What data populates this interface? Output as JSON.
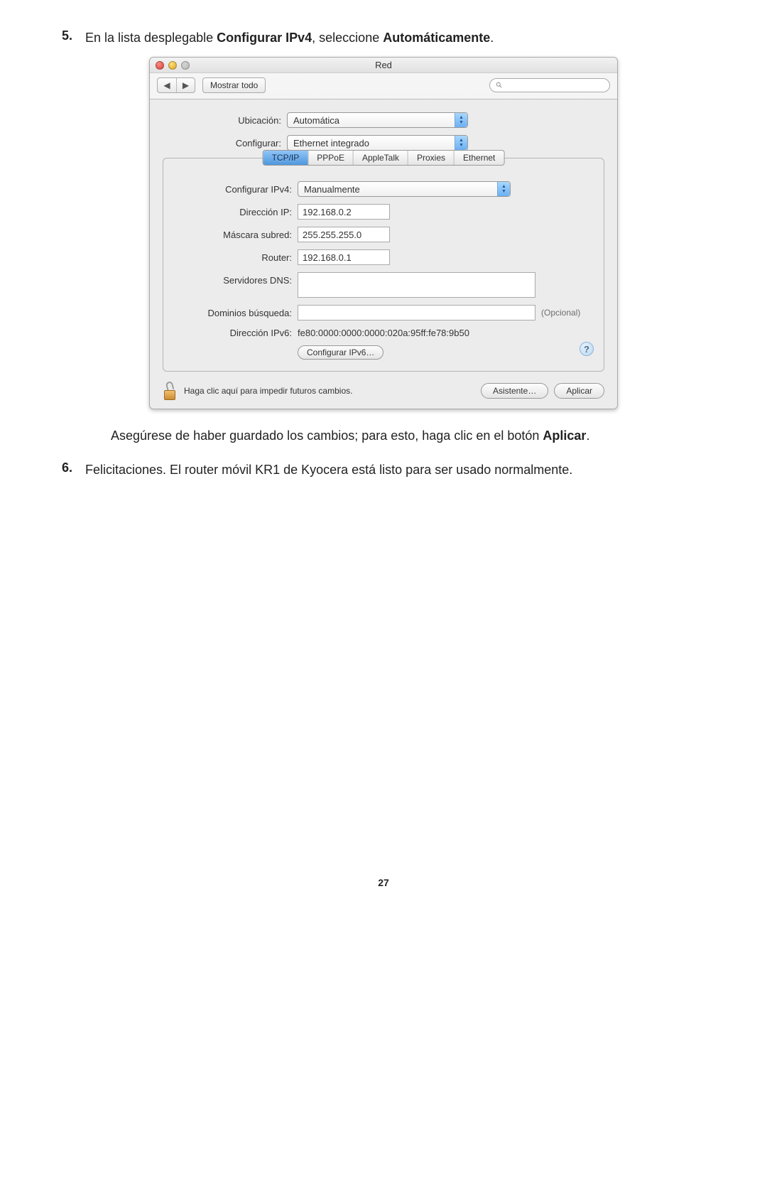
{
  "instructions": {
    "step5_num": "5.",
    "step5_pre": "En la lista desplegable ",
    "step5_b1": "Configurar IPv4",
    "step5_mid": ", seleccione ",
    "step5_b2": "Automáticamente",
    "step5_post": ".",
    "after1a": "Asegúrese de haber guardado los cambios; para esto, haga clic en el botón ",
    "after1b": "Aplicar",
    "after1c": ".",
    "step6_num": "6.",
    "step6_text": "Felicitaciones. El router móvil KR1 de Kyocera está listo para ser usado normalmente."
  },
  "window": {
    "title": "Red",
    "show_all": "Mostrar todo",
    "location_label": "Ubicación:",
    "location_value": "Automática",
    "configure_label": "Configurar:",
    "configure_value": "Ethernet integrado",
    "tabs": {
      "tcpip": "TCP/IP",
      "pppoe": "PPPoE",
      "appletalk": "AppleTalk",
      "proxies": "Proxies",
      "ethernet": "Ethernet"
    },
    "ipv4_label": "Configurar IPv4:",
    "ipv4_value": "Manualmente",
    "ip_label": "Dirección IP:",
    "ip_value": "192.168.0.2",
    "subnet_label": "Máscara subred:",
    "subnet_value": "255.255.255.0",
    "router_label": "Router:",
    "router_value": "192.168.0.1",
    "dns_label": "Servidores DNS:",
    "searchdom_label": "Dominios búsqueda:",
    "optional": "(Opcional)",
    "ipv6_label": "Dirección IPv6:",
    "ipv6_value": "fe80:0000:0000:0000:020a:95ff:fe78:9b50",
    "ipv6_btn": "Configurar IPv6…",
    "lock_text": "Haga clic aquí para impedir futuros cambios.",
    "assist_btn": "Asistente…",
    "apply_btn": "Aplicar",
    "help": "?"
  },
  "page_number": "27"
}
